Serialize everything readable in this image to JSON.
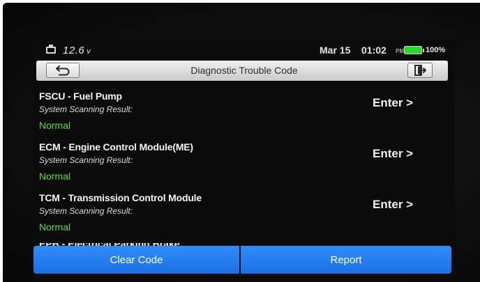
{
  "status_bar": {
    "voltage": "12.6",
    "voltage_unit": "v",
    "date": "Mar 15",
    "time": "01:02",
    "ampm": "PM",
    "battery_percent": "100%",
    "battery_level": 1.0,
    "battery_color": "#2bd92b"
  },
  "header": {
    "title": "Diagnostic Trouble Code",
    "back_icon": "back-arrow-icon",
    "exit_icon": "exit-door-icon"
  },
  "modules": [
    {
      "name": "FSCU - Fuel Pump",
      "scan_label": "System Scanning Result:",
      "status": "Normal",
      "action": "Enter >"
    },
    {
      "name": "ECM - Engine Control Module(ME)",
      "scan_label": "System Scanning Result:",
      "status": "Normal",
      "action": "Enter >"
    },
    {
      "name": "TCM - Transmission Control Module",
      "scan_label": "System Scanning Result:",
      "status": "Normal",
      "action": "Enter >"
    }
  ],
  "partial_module": {
    "name": "EPB - Electrical Parking Brake"
  },
  "footer": {
    "clear_code": "Clear Code",
    "report": "Report"
  },
  "colors": {
    "status_normal": "#5bdc3a",
    "button_blue": "#2a86f5"
  }
}
